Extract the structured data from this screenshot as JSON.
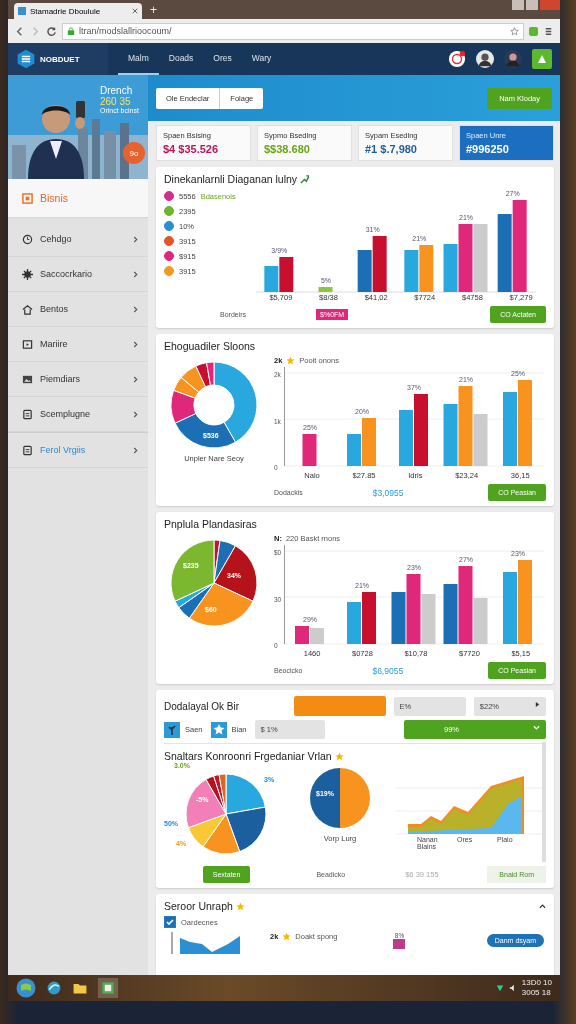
{
  "browser": {
    "tab_title": "Stamadrie Dboulule",
    "new_tab": "+",
    "url": "ltran/modslallrioocoum/"
  },
  "app": {
    "logo": "NOBDUET",
    "nav": [
      {
        "label": "Malm",
        "selected": true
      },
      {
        "label": "Doads",
        "selected": false
      },
      {
        "label": "Ores",
        "selected": false
      },
      {
        "label": "Wary",
        "selected": false
      }
    ]
  },
  "hero": {
    "title": "Drench",
    "value": "260 35",
    "subtitle": "Orinct bcinst",
    "badge": "9o"
  },
  "sidebar": [
    {
      "label": "Bisnis",
      "kind": "section",
      "selected": true
    },
    {
      "label": "Cehdgo",
      "kind": "item",
      "selected": false
    },
    {
      "label": "Saccocrkario",
      "kind": "item",
      "selected": false
    },
    {
      "label": "Bentos",
      "kind": "item",
      "selected": false
    },
    {
      "label": "Mariire",
      "kind": "item",
      "selected": false
    },
    {
      "label": "Piemdiars",
      "kind": "item",
      "selected": false
    },
    {
      "label": "Scemplugne",
      "kind": "item",
      "selected": false
    },
    {
      "label": "Ferol Vrgiis",
      "kind": "link",
      "selected": false
    }
  ],
  "toolbar": {
    "segments": [
      "Ole Endeclar",
      "Folage"
    ],
    "action": "Nam Kloday"
  },
  "stats": [
    {
      "label": "Spaen Bsising",
      "value": "$4 $35.526",
      "color": "#c0145a",
      "highlighted": false
    },
    {
      "label": "Sypmo Bsedlng",
      "value": "$$38.680",
      "color": "#6aa519",
      "highlighted": false
    },
    {
      "label": "Sypam Esedlng",
      "value": "#1 $.7,980",
      "color": "#1f5f9e",
      "highlighted": false
    },
    {
      "label": "Spaen Unre",
      "value": "#996250",
      "color": "#ffffff",
      "highlighted": true
    }
  ],
  "card1": {
    "title": "Dinekanlarnli Diaganan lulny",
    "legend_note": "Bdasenois",
    "legend": [
      {
        "label": "5556",
        "color": "#d0308a"
      },
      {
        "label": "2395",
        "color": "#6cb52d"
      },
      {
        "label": "10%",
        "color": "#2a8fd0"
      },
      {
        "label": "3915",
        "color": "#e5542a"
      },
      {
        "label": "$915",
        "color": "#e0287a"
      },
      {
        "label": "3915",
        "color": "#f09a20"
      }
    ],
    "bar_labels": [
      "3/9%",
      "5%",
      "31%",
      "21%",
      "21%",
      "27%"
    ],
    "x_labels": [
      "$5,709",
      "$8/38",
      "$41,02",
      "$7724",
      "$4758",
      "$7,279"
    ],
    "footer_label": "Bordeirs",
    "badge": "$%0FM",
    "button": "CO Actaten"
  },
  "card2": {
    "title": "Ehoguadiler Sloons",
    "donut_label": "$536",
    "caption": "Unpler Nare Seoy",
    "chart_header": "2k",
    "chart_legend": "Pooit onons",
    "y_ticks": [
      "2k",
      "1k",
      "0"
    ],
    "bar_labels": [
      "25%",
      "20%",
      "37%",
      "21%",
      "25%"
    ],
    "x_labels": [
      "Nalo",
      "$27.85",
      "Idris",
      "$23,24",
      "36,15"
    ],
    "footer_label": "Dodackis",
    "footer_value": "$3,0955",
    "button": "CO Peasian"
  },
  "card3": {
    "title": "Pnplula Plandasiras",
    "slice_labels": [
      "$235",
      "34%",
      "$60"
    ],
    "chart_header": "N:",
    "chart_legend": "220 Baskt rnons",
    "y_ticks": [
      "$0",
      "30",
      "0"
    ],
    "bar_labels": [
      "29%",
      "21%",
      "23%",
      "27%",
      "23%"
    ],
    "x_labels": [
      "1460",
      "$0728",
      "$10,78",
      "$7720",
      "$5,15"
    ],
    "footer_label": "Beocicko",
    "footer_value": "$6,9055",
    "button": "CO Peasian"
  },
  "card4": {
    "title": "Dodalayal Ok Bir",
    "fields": [
      "E%",
      "$22%"
    ],
    "icon_buttons": [
      "Saen",
      "Bian"
    ],
    "amount": "$ 1%",
    "select": "99%",
    "inner": {
      "title": "Snaltars Konroonri Frgedaniar Vrlan",
      "pie_labels": [
        "3.0%",
        "3%",
        "-5%",
        "50%",
        "4%"
      ],
      "half_pie_label": "$19%",
      "half_pie_caption": "Vorp Lurg",
      "x_labels": [
        "Nanan Blains",
        "Ores",
        "Plaio"
      ]
    },
    "primary_button": "Sextaten",
    "footer_label": "Beadicko",
    "footer_value": "$6 39 155",
    "secondary_button": "Bnaid Rom"
  },
  "card5": {
    "title": "Seroor Unraph",
    "checkbox": {
      "label": "Oardecnes",
      "checked": true
    },
    "chart_header": "2k",
    "chart_legend": "Doakt spong",
    "bar_label": "8%",
    "pill": "Danm dsyam"
  },
  "taskbar": {
    "clock": [
      "13D0 10",
      "3005 18"
    ]
  }
}
